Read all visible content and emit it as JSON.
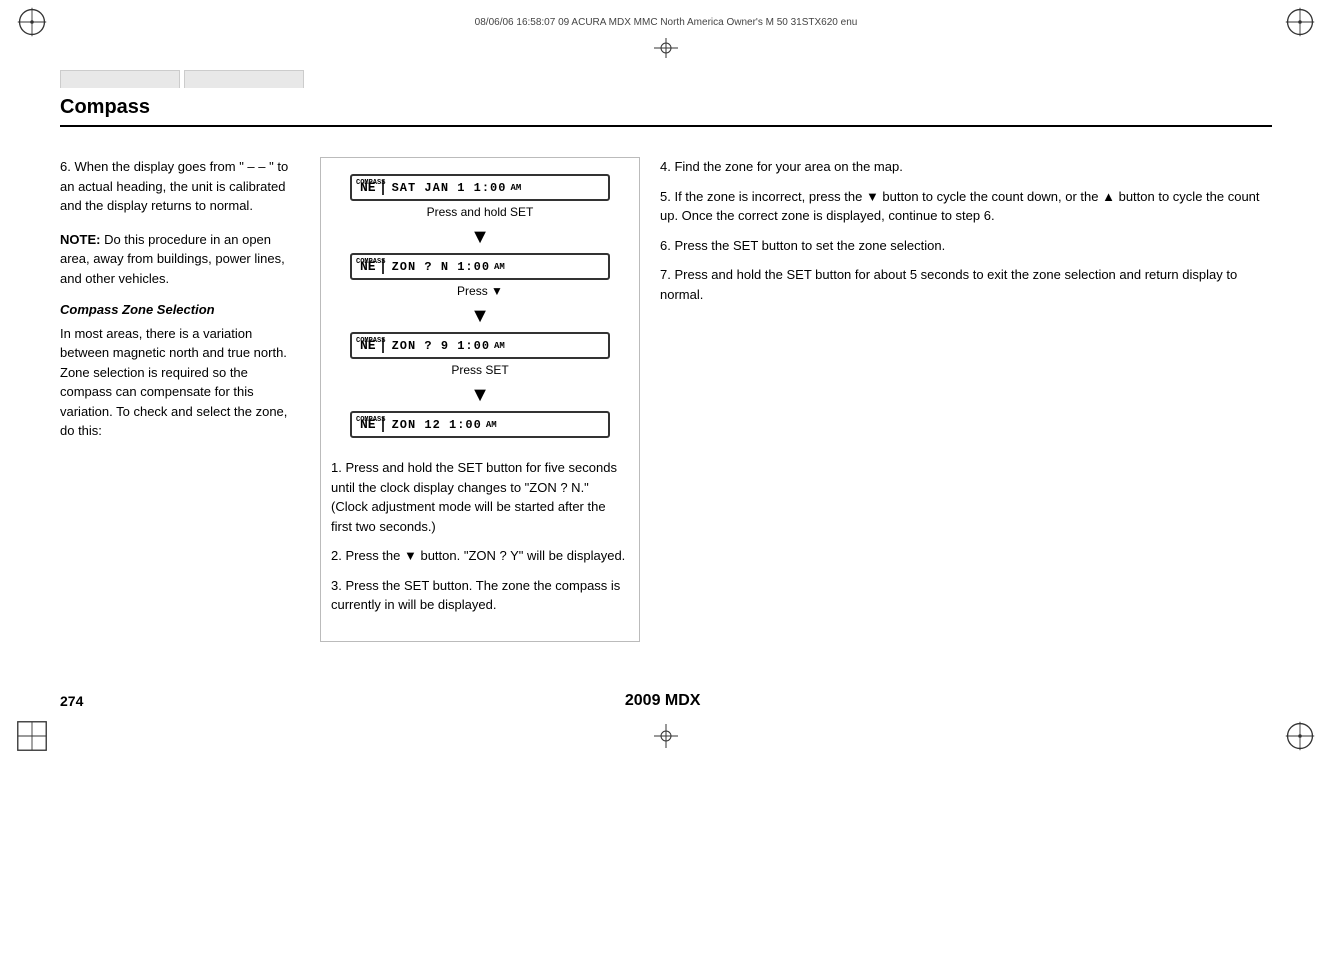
{
  "header": {
    "file_info": "08/06/06  16:58:07    09 ACURA MDX MMC North America Owner's M 50 31STX620 enu"
  },
  "nav_tabs": [
    {
      "label": ""
    },
    {
      "label": ""
    }
  ],
  "section_title": "Compass",
  "left_col": {
    "step6": {
      "text": "6. When the display goes from \" – – \" to an actual heading, the unit is calibrated and the display returns to normal."
    },
    "note": {
      "label": "NOTE:",
      "text": " Do this procedure in an open area, away from buildings, power lines, and other vehicles."
    },
    "subsection": {
      "title": "Compass Zone Selection",
      "text": "In most areas, there is a variation between magnetic north and true north. Zone selection is required so the compass can compensate for this variation. To check and select the zone, do this:"
    }
  },
  "center_col": {
    "screens": [
      {
        "compass": "COMPASS",
        "ne": "NE",
        "main_text": "SAT JAN  1  1:00",
        "suffix": "AM"
      },
      {
        "compass": "COMPASS",
        "ne": "NE",
        "main_text": "ZON ? N    1:00",
        "suffix": "AM"
      },
      {
        "compass": "COMPASS",
        "ne": "NE",
        "main_text": "ZON ? 9    1:00",
        "suffix": "AM"
      },
      {
        "compass": "COMPASS",
        "ne": "NE",
        "main_text": "ZON  12    1:00",
        "suffix": "AM"
      }
    ],
    "caption1": "Press and hold SET",
    "caption2": "Press ▼",
    "caption3": "Press SET"
  },
  "right_col": {
    "steps": [
      {
        "number": "1.",
        "text": "Press and hold the SET button for five seconds until the clock display changes to \"ZON ? N.\" (Clock adjustment mode will be started after the first two seconds.)"
      },
      {
        "number": "2.",
        "text": "Press the ▼ button. \"ZON ? Y\" will be displayed."
      },
      {
        "number": "3.",
        "text": "Press the SET button. The zone the compass is currently in will be displayed."
      },
      {
        "number": "4.",
        "text": "Find the zone for your area on the map."
      },
      {
        "number": "5.",
        "text": "If the zone is incorrect, press the ▼ button to cycle the count down, or the ▲ button to cycle the count up. Once the correct zone is displayed, continue to step 6."
      },
      {
        "number": "6.",
        "text": "Press the SET button to set the zone selection."
      },
      {
        "number": "7.",
        "text": "Press and hold the SET button for about 5 seconds to exit the zone selection and return display to normal."
      }
    ]
  },
  "footer": {
    "page_number": "274",
    "model_year": "2009  MDX"
  }
}
